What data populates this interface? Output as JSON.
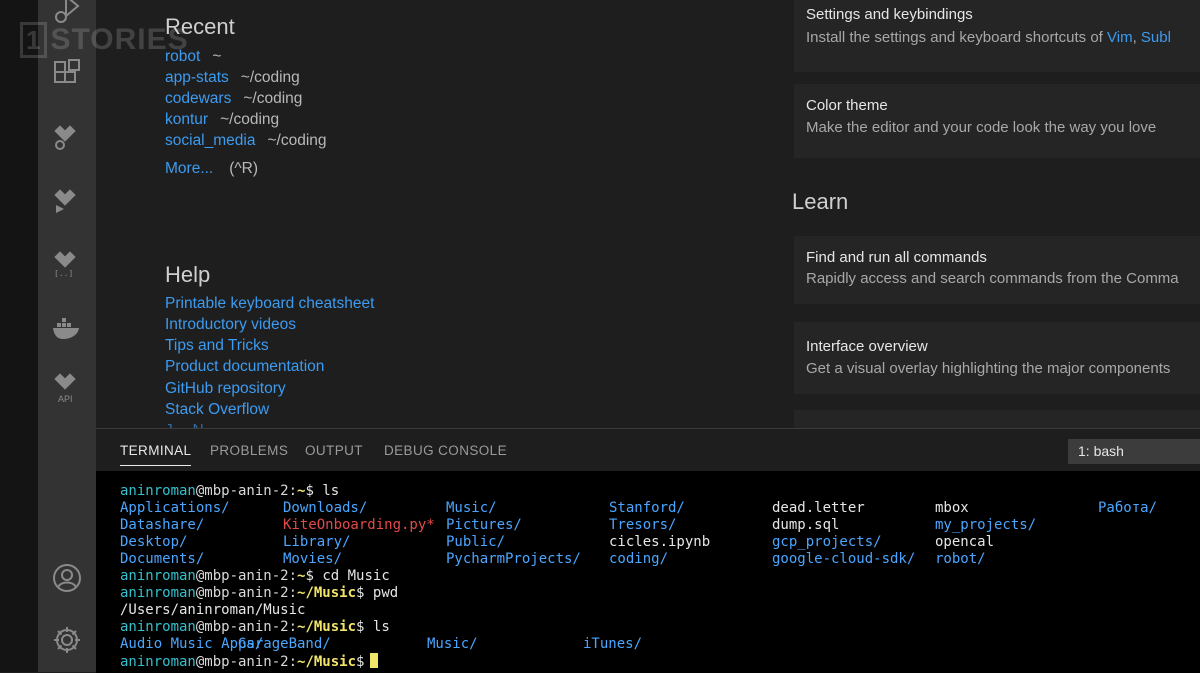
{
  "watermark": {
    "box": "1",
    "text": "STORIES"
  },
  "welcome": {
    "recent": {
      "title": "Recent",
      "items": [
        {
          "name": "robot",
          "path": "~"
        },
        {
          "name": "app-stats",
          "path": "~/coding"
        },
        {
          "name": "codewars",
          "path": "~/coding"
        },
        {
          "name": "kontur",
          "path": "~/coding"
        },
        {
          "name": "social_media",
          "path": "~/coding"
        }
      ],
      "more": "More...",
      "more_shortcut": "(^R)"
    },
    "help": {
      "title": "Help",
      "links": [
        "Printable keyboard cheatsheet",
        "Introductory videos",
        "Tips and Tricks",
        "Product documentation",
        "GitHub repository",
        "Stack Overflow"
      ]
    },
    "customize": {
      "cards": [
        {
          "title": "Settings and keybindings",
          "desc_prefix": "Install the settings and keyboard shortcuts of ",
          "link1": "Vim",
          "sep": ", ",
          "link2": "Subl"
        },
        {
          "title": "Color theme",
          "desc": "Make the editor and your code look the way you love"
        }
      ]
    },
    "learn": {
      "title": "Learn",
      "cards": [
        {
          "title": "Find and run all commands",
          "desc": "Rapidly access and search commands from the Comma"
        },
        {
          "title": "Interface overview",
          "desc": "Get a visual overlay highlighting the major components"
        }
      ]
    }
  },
  "panel": {
    "tabs": [
      "TERMINAL",
      "PROBLEMS",
      "OUTPUT",
      "DEBUG CONSOLE"
    ],
    "active_tab": "TERMINAL",
    "terminal_select": "1: bash"
  },
  "terminal": {
    "prompt_user": "aninroman",
    "prompt_host": "@mbp-anin-2:",
    "ls_columns": [
      [
        "Applications/",
        "Datashare/",
        "Desktop/",
        "Documents/"
      ],
      [
        "Downloads/",
        "KiteOnboarding.py*",
        "Library/",
        "Movies/"
      ],
      [
        "Music/",
        "Pictures/",
        "Public/",
        "PycharmProjects/"
      ],
      [
        "Stanford/",
        "Tresors/",
        "cicles.ipynb",
        "coding/"
      ],
      [
        "dead.letter",
        "dump.sql",
        "gcp_projects/",
        "google-cloud-sdk/"
      ],
      [
        "mbox",
        "my_projects/",
        "opencal",
        "robot/"
      ],
      [
        "Работа/",
        "",
        "",
        ""
      ]
    ],
    "lines": [
      {
        "dir": "~",
        "cmd": " ls"
      },
      {
        "dir": "~",
        "cmd": " cd Music"
      },
      {
        "dir": "~/Music",
        "cmd": " pwd"
      },
      {
        "output": "/Users/aninroman/Music"
      },
      {
        "dir": "~/Music",
        "cmd": " ls"
      },
      {
        "dir": "~/Music",
        "cmd": ""
      }
    ],
    "music_ls": [
      "Audio Music Apps/",
      "GarageBand/",
      "Music/",
      "iTunes/"
    ]
  }
}
